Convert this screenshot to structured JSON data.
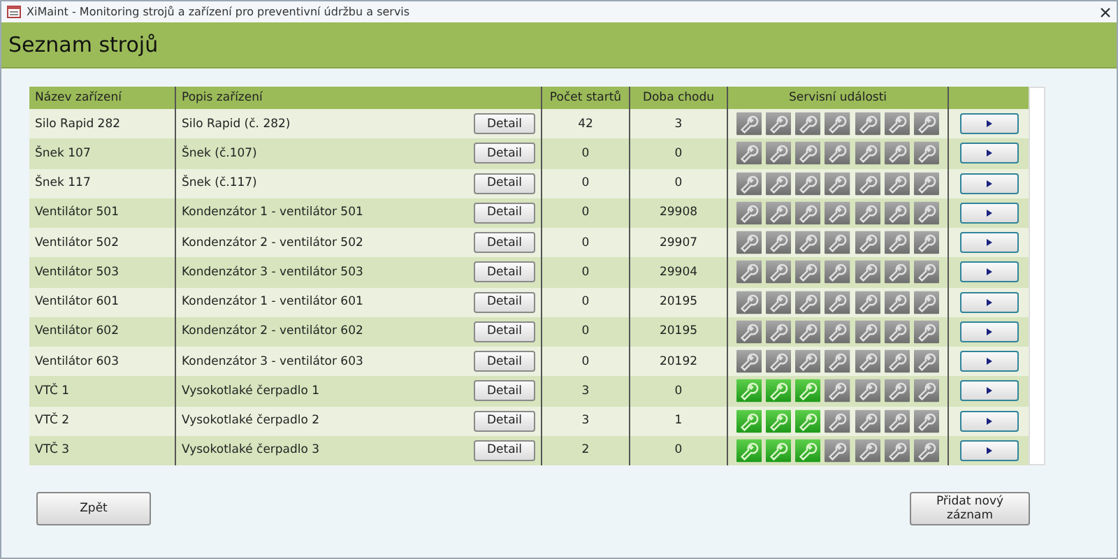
{
  "window": {
    "title": "XiMaint - Monitoring strojů a zařízení pro preventivní údržbu a servis"
  },
  "header": {
    "title": "Seznam strojů"
  },
  "table": {
    "columns": [
      "Název zařízení",
      "Popis zařízení",
      "Počet startů",
      "Doba chodu",
      "Servisní události"
    ],
    "rows": [
      {
        "name": "Silo Rapid 282",
        "description": "Silo Rapid (č. 282)",
        "detail": "Detail",
        "starts": "42",
        "runtime": "3",
        "events": [
          false,
          false,
          false,
          false,
          false,
          false,
          false
        ]
      },
      {
        "name": "Šnek 107",
        "description": "Šnek (č.107)",
        "detail": "Detail",
        "starts": "0",
        "runtime": "0",
        "events": [
          false,
          false,
          false,
          false,
          false,
          false,
          false
        ]
      },
      {
        "name": "Šnek 117",
        "description": "Šnek (č.117)",
        "detail": "Detail",
        "starts": "0",
        "runtime": "0",
        "events": [
          false,
          false,
          false,
          false,
          false,
          false,
          false
        ]
      },
      {
        "name": "Ventilátor 501",
        "description": "Kondenzátor 1 - ventilátor 501",
        "detail": "Detail",
        "starts": "0",
        "runtime": "29908",
        "events": [
          false,
          false,
          false,
          false,
          false,
          false,
          false
        ]
      },
      {
        "name": "Ventilátor 502",
        "description": "Kondenzátor 2 - ventilátor 502",
        "detail": "Detail",
        "starts": "0",
        "runtime": "29907",
        "events": [
          false,
          false,
          false,
          false,
          false,
          false,
          false
        ]
      },
      {
        "name": "Ventilátor 503",
        "description": "Kondenzátor 3 - ventilátor 503",
        "detail": "Detail",
        "starts": "0",
        "runtime": "29904",
        "events": [
          false,
          false,
          false,
          false,
          false,
          false,
          false
        ]
      },
      {
        "name": "Ventilátor 601",
        "description": "Kondenzátor 1 - ventilátor 601",
        "detail": "Detail",
        "starts": "0",
        "runtime": "20195",
        "events": [
          false,
          false,
          false,
          false,
          false,
          false,
          false
        ]
      },
      {
        "name": "Ventilátor 602",
        "description": "Kondenzátor 2 - ventilátor 602",
        "detail": "Detail",
        "starts": "0",
        "runtime": "20195",
        "events": [
          false,
          false,
          false,
          false,
          false,
          false,
          false
        ]
      },
      {
        "name": "Ventilátor 603",
        "description": "Kondenzátor 3 - ventilátor 603",
        "detail": "Detail",
        "starts": "0",
        "runtime": "20192",
        "events": [
          false,
          false,
          false,
          false,
          false,
          false,
          false
        ]
      },
      {
        "name": "VTČ 1",
        "description": "Vysokotlaké čerpadlo 1",
        "detail": "Detail",
        "starts": "3",
        "runtime": "0",
        "events": [
          true,
          true,
          true,
          false,
          false,
          false,
          false
        ]
      },
      {
        "name": "VTČ 2",
        "description": "Vysokotlaké čerpadlo 2",
        "detail": "Detail",
        "starts": "3",
        "runtime": "1",
        "events": [
          true,
          true,
          true,
          false,
          false,
          false,
          false
        ]
      },
      {
        "name": "VTČ 3",
        "description": "Vysokotlaké čerpadlo 3",
        "detail": "Detail",
        "starts": "2",
        "runtime": "0",
        "events": [
          true,
          true,
          true,
          false,
          false,
          false,
          false
        ]
      }
    ]
  },
  "buttons": {
    "back": "Zpět",
    "add": "Přidat nový záznam"
  }
}
